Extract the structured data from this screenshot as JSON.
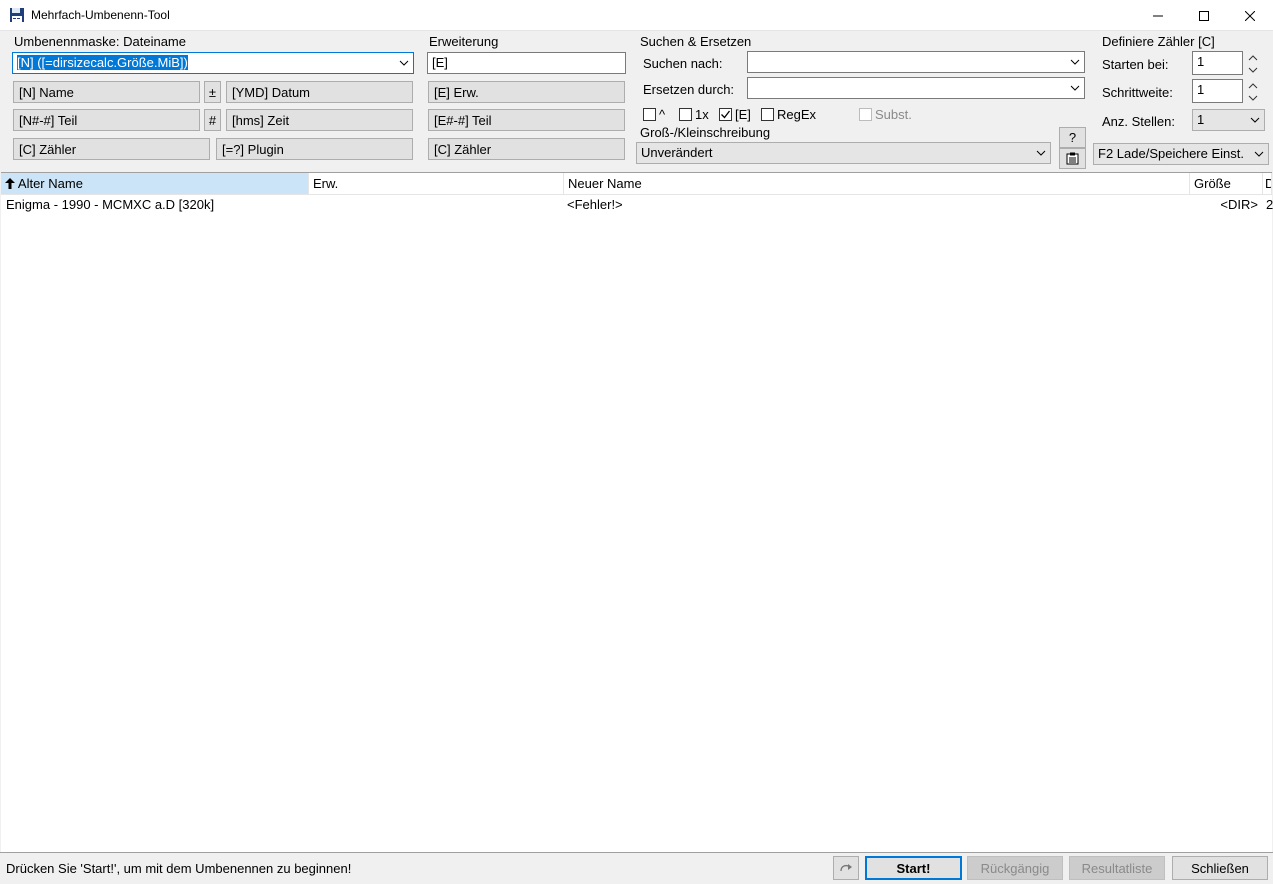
{
  "window": {
    "title": "Mehrfach-Umbenenn-Tool",
    "icon": "floppy-disk-icon",
    "controls": [
      "minimize-icon",
      "maximize-icon",
      "close-icon"
    ]
  },
  "mask": {
    "label": "Umbenennmaske: Dateiname",
    "value": "[N] ([=dirsizecalc.Größe.MiB])",
    "buttons": {
      "name": "[N]  Name",
      "plusminus": "±",
      "datum": "[YMD]  Datum",
      "teil": "[N#-#] Teil",
      "hash": "#",
      "zeit": "[hms]  Zeit",
      "zaehler": "[C]  Zähler",
      "plugin": "[=?]  Plugin"
    }
  },
  "extension": {
    "label": "Erweiterung",
    "value": "[E]",
    "buttons": {
      "erw": "[E]  Erw.",
      "teil": "[E#-#] Teil",
      "zaehler": "[C]  Zähler"
    }
  },
  "search": {
    "label": "Suchen & Ersetzen",
    "search_label": "Suchen nach:",
    "search_value": "",
    "replace_label": "Ersetzen durch:",
    "replace_value": "",
    "checks": {
      "caret": {
        "label": "^",
        "checked": false
      },
      "once": {
        "label": "1x",
        "checked": false
      },
      "ext": {
        "label": "[E]",
        "checked": true
      },
      "regex": {
        "label": "RegEx",
        "checked": false
      },
      "subst": {
        "label": "Subst.",
        "checked": false,
        "disabled": true
      }
    }
  },
  "case": {
    "label": "Groß-/Kleinschreibung",
    "value": "Unverändert",
    "help_button": "?",
    "copy_button_icon": "clipboard-list-icon"
  },
  "counter": {
    "label": "Definiere Zähler [C]",
    "start_label": "Starten bei:",
    "start_value": "1",
    "step_label": "Schrittweite:",
    "step_value": "1",
    "digits_label": "Anz. Stellen:",
    "digits_value": "1",
    "load_save": "F2 Lade/Speichere Einst."
  },
  "list": {
    "columns": [
      "Alter Name",
      "Erw.",
      "Neuer Name",
      "Größe",
      "D"
    ],
    "sort_icon": "arrow-up-icon",
    "rows": [
      {
        "alter": "Enigma - 1990 - MCMXC a.D  [320k]",
        "erw": "",
        "neu": "<Fehler!>",
        "groesse": "<DIR>",
        "d": "2"
      }
    ]
  },
  "status": {
    "message": "Drücken Sie 'Start!', um mit dem Umbenennen zu beginnen!",
    "redo_icon": "redo-arrow-icon",
    "start": "Start!",
    "undo": "Rückgängig",
    "result": "Resultatliste",
    "close": "Schließen"
  }
}
